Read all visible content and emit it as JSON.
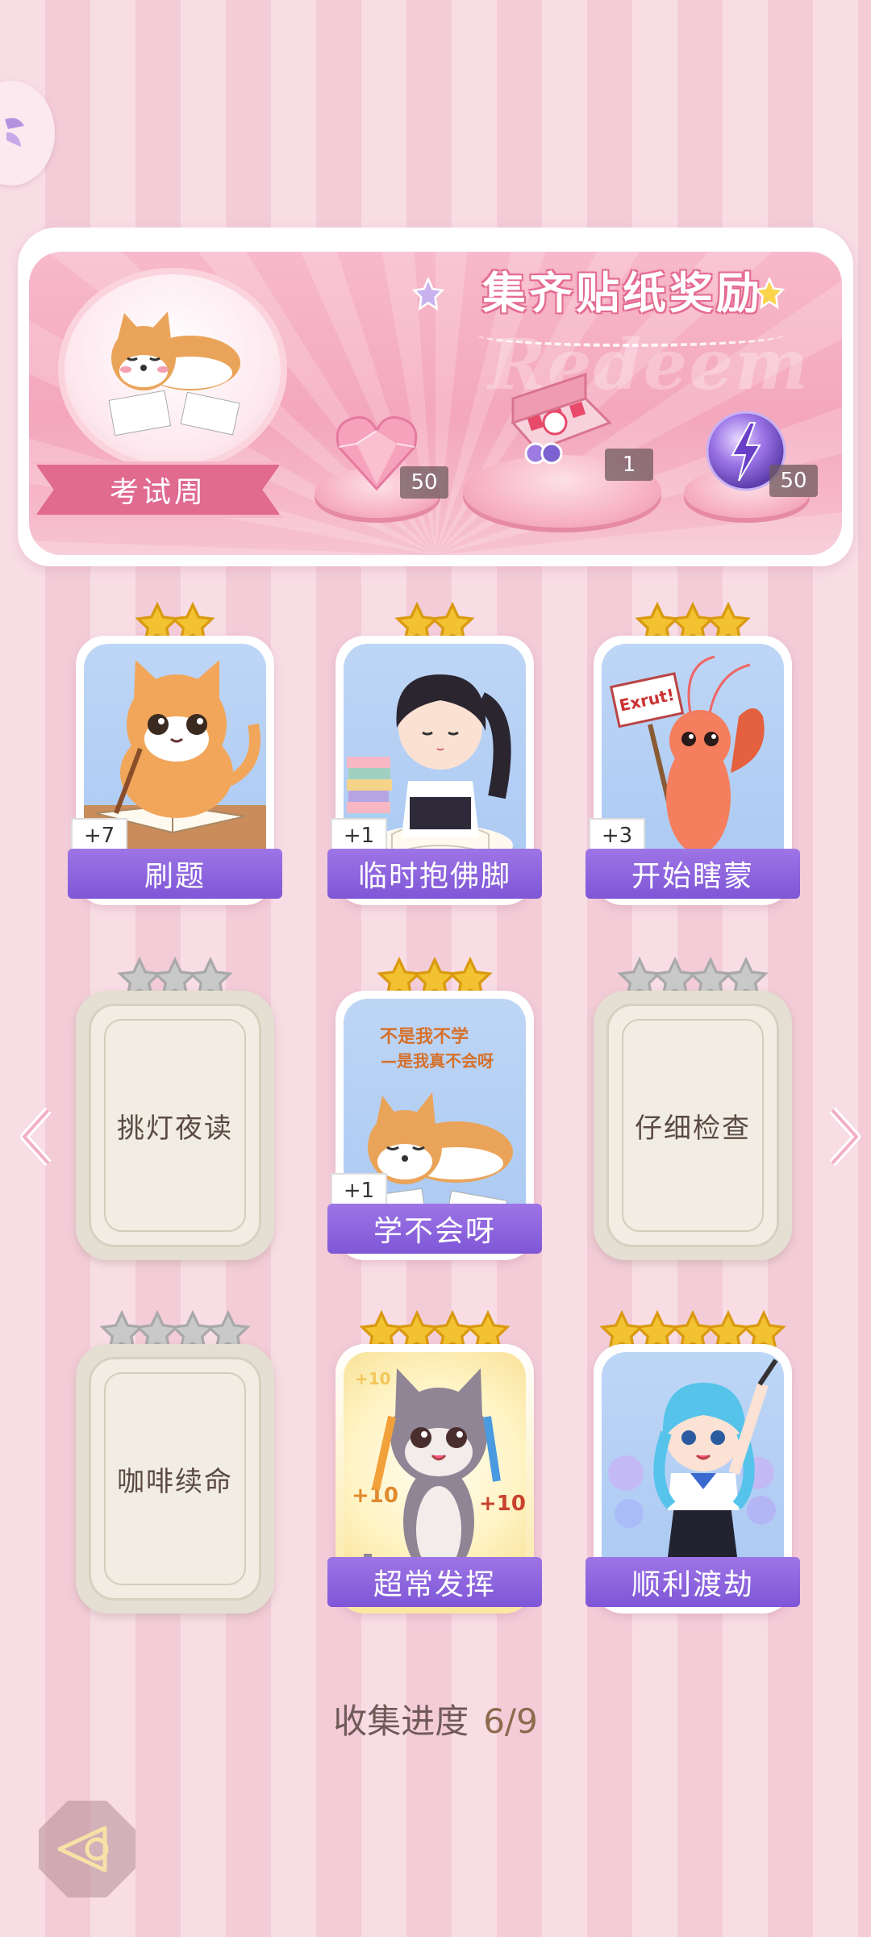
{
  "banner": {
    "title": "集齐贴纸奖励",
    "watermark": "Redeem",
    "theme_label": "考试周",
    "rewards": [
      {
        "icon": "pink-heart-gem-icon",
        "count": "50"
      },
      {
        "icon": "gift-box-icon",
        "count": "1"
      },
      {
        "icon": "purple-lightning-orb-icon",
        "count": "50"
      }
    ]
  },
  "cards": [
    {
      "name": "刷题",
      "stars": 2,
      "collected": true,
      "plus": "+7",
      "art": "orange-cat-studying"
    },
    {
      "name": "临时抱佛脚",
      "stars": 2,
      "collected": true,
      "plus": "+1",
      "art": "girl-reading"
    },
    {
      "name": "开始瞎蒙",
      "stars": 3,
      "collected": true,
      "plus": "+3",
      "art": "shrimp-with-sign",
      "sign_text": "Exrut!"
    },
    {
      "name": "挑灯夜读",
      "stars": 3,
      "collected": false
    },
    {
      "name": "学不会呀",
      "stars": 3,
      "collected": true,
      "plus": "+1",
      "art": "shiba-lying",
      "caption_line1": "不是我不学",
      "caption_line2": "—是我真不会呀"
    },
    {
      "name": "仔细检查",
      "stars": 4,
      "collected": false
    },
    {
      "name": "咖啡续命",
      "stars": 4,
      "collected": false
    },
    {
      "name": "超常发挥",
      "stars": 4,
      "collected": true,
      "gold": true,
      "art": "cat-with-pencils",
      "bonus_text": "+10"
    },
    {
      "name": "顺利渡劫",
      "stars": 5,
      "collected": true,
      "art": "blue-hair-girl"
    }
  ],
  "progress": {
    "label": "收集进度",
    "value": "6/9"
  },
  "colors": {
    "accent_purple": "#8a62dc",
    "ribbon_pink": "#e06a90",
    "star_gold": "#f2c230",
    "star_grey": "#c9c9c9"
  }
}
